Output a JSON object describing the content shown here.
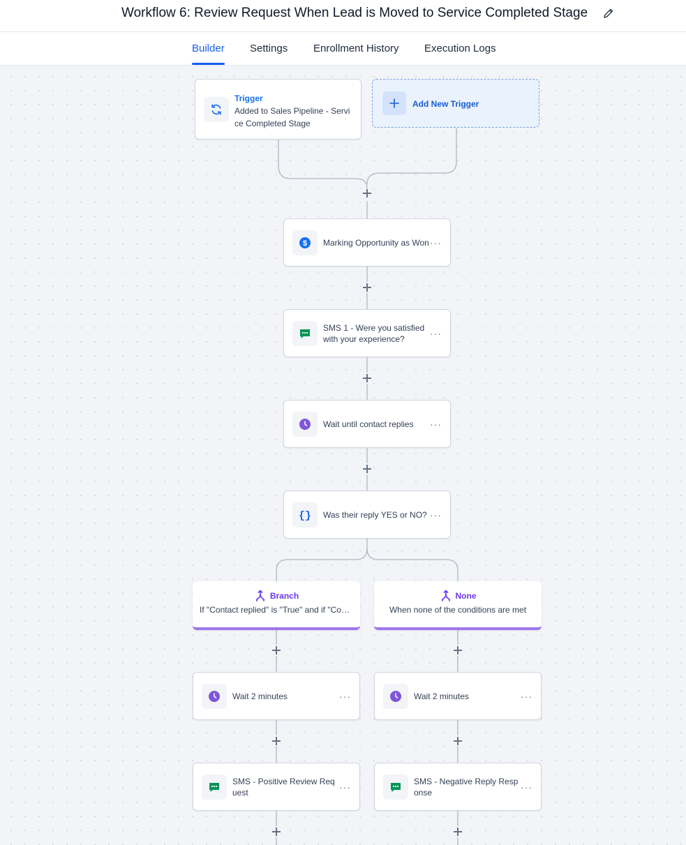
{
  "header": {
    "title": "Workflow 6: Review Request When Lead is Moved to Service Completed Stage"
  },
  "tabs": [
    {
      "label": "Builder",
      "active": true
    },
    {
      "label": "Settings",
      "active": false
    },
    {
      "label": "Enrollment History",
      "active": false
    },
    {
      "label": "Execution Logs",
      "active": false
    }
  ],
  "trigger": {
    "title": "Trigger",
    "description": "Added to Sales Pipeline - Service Completed Stage"
  },
  "add_trigger": {
    "label": "Add New Trigger"
  },
  "actions": {
    "mark_won": {
      "label": "Marking Opportunity as Won",
      "icon": "dollar-icon"
    },
    "sms1": {
      "label": "SMS 1 - Were you satisfied with your experience?",
      "icon": "chat-icon"
    },
    "wait_reply": {
      "label": "Wait until contact replies",
      "icon": "clock-icon"
    },
    "condition": {
      "label": "Was their reply YES or NO?",
      "icon": "braces-icon"
    }
  },
  "branches": {
    "left": {
      "title": "Branch",
      "subtitle": "If \"Contact replied\" is \"True\" and if \"Contact replied\" is \"Yes\"",
      "wait": "Wait 2 minutes",
      "sms": "SMS - Positive Review Request"
    },
    "right": {
      "title": "None",
      "subtitle": "When none of the conditions are met",
      "wait": "Wait 2 minutes",
      "sms": "SMS - Negative Reply Response"
    }
  },
  "more_label": "···",
  "colors": {
    "accent": "#155eef",
    "branch": "#9e77ed",
    "sms_green": "#079455",
    "wait_purple": "#7f56d9",
    "dollar_blue": "#1570ef"
  }
}
